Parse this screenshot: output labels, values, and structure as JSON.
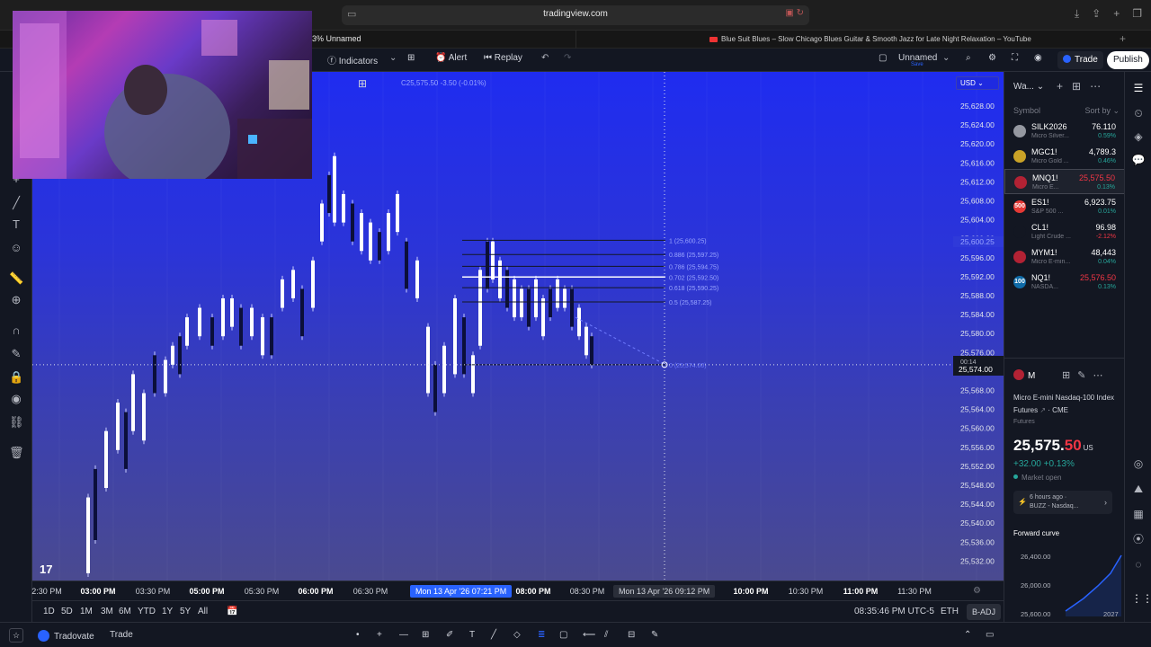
{
  "browser": {
    "url": "tradingview.com",
    "tab_left": "3% Unnamed",
    "tab_youtube": "Blue Suit Blues – Slow Chicago Blues Guitar & Smooth Jazz for Late Night Relaxation – YouTube"
  },
  "toolbar": {
    "indicators_label": "Indicators",
    "alert_label": "Alert",
    "replay_label": "Replay",
    "layout_name": "Unnamed",
    "layout_sub": "Save",
    "trade_label": "Trade",
    "publish_label": "Publish"
  },
  "chart": {
    "currency": "USD",
    "legend_ohlc": "C25,575.50  -3.50 (-0.01%)",
    "price_labels": [
      "25,628.00",
      "25,624.00",
      "25,620.00",
      "25,616.00",
      "25,612.00",
      "25,608.00",
      "25,604.00",
      "25,600.00",
      "25,596.00",
      "25,592.00",
      "25,588.00",
      "25,584.00",
      "25,580.00",
      "25,576.00",
      "25,572.00",
      "25,568.00",
      "25,564.00",
      "25,560.00",
      "25,556.00",
      "25,552.00",
      "25,548.00",
      "25,544.00",
      "25,540.00",
      "25,536.00",
      "25,532.00"
    ],
    "highlight_price_top": "25,600.25",
    "crosshair_price": "25,574.00",
    "crosshair_price_sub": "00:14",
    "fib_levels": [
      {
        "label": "1 (25,600.25)"
      },
      {
        "label": "0.886 (25,597.25)"
      },
      {
        "label": "0.786 (25,594.75)"
      },
      {
        "label": "0.702 (25,592.50)"
      },
      {
        "label": "0.618 (25,590.25)"
      },
      {
        "label": "0.5 (25,587.25)"
      },
      {
        "label": "0 (25,574.00)"
      }
    ],
    "time_labels": [
      {
        "text": "2:30 PM",
        "bold": false
      },
      {
        "text": "03:00 PM",
        "bold": true
      },
      {
        "text": "03:30 PM",
        "bold": false
      },
      {
        "text": "05:00 PM",
        "bold": true
      },
      {
        "text": "05:30 PM",
        "bold": false
      },
      {
        "text": "06:00 PM",
        "bold": true
      },
      {
        "text": "06:30 PM",
        "bold": false
      },
      {
        "text": "08:00 PM",
        "bold": true
      },
      {
        "text": "08:30 PM",
        "bold": false
      },
      {
        "text": "10:00 PM",
        "bold": true
      },
      {
        "text": "10:30 PM",
        "bold": false
      },
      {
        "text": "11:00 PM",
        "bold": true
      },
      {
        "text": "11:30 PM",
        "bold": false
      }
    ],
    "time_range_start": "Mon 13 Apr '26  07:21 PM",
    "time_crosshair": "Mon 13 Apr '26  09:12 PM",
    "ranges": [
      "1D",
      "5D",
      "1M",
      "3M",
      "6M",
      "YTD",
      "1Y",
      "5Y",
      "All"
    ],
    "clock": "08:35:46 PM UTC-5",
    "session": "ETH",
    "adjust": "B-ADJ"
  },
  "bottom": {
    "broker": "Tradovate",
    "trade": "Trade"
  },
  "watchlist": {
    "title": "Wa...",
    "col_symbol": "Symbol",
    "col_sort": "Sort by",
    "items": [
      {
        "symbol": "SILK2026",
        "desc": "Micro Silver...",
        "last": "76.110",
        "chg": "0.59%",
        "up": true,
        "color": "#9598a1",
        "badge": ""
      },
      {
        "symbol": "MGC1!",
        "desc": "Micro Gold ...",
        "last": "4,789.3",
        "chg": "0.46%",
        "up": true,
        "color": "#c9a227",
        "badge": ""
      },
      {
        "symbol": "MNQ1!",
        "desc": "Micro E...",
        "last": "25,575.50",
        "chg": "0.13%",
        "up": true,
        "color": "#b22234",
        "badge": "",
        "selected": true,
        "last_red": true
      },
      {
        "symbol": "ES1!",
        "desc": "S&P 500 ...",
        "last": "6,923.75",
        "chg": "0.01%",
        "up": true,
        "color": "#e53935",
        "badge": "500"
      },
      {
        "symbol": "CL1!",
        "desc": "Light Crude ...",
        "last": "96.98",
        "chg": "-2.12%",
        "up": false,
        "color": "#131722",
        "badge": ""
      },
      {
        "symbol": "MYM1!",
        "desc": "Micro E-min...",
        "last": "48,443",
        "chg": "0.04%",
        "up": true,
        "color": "#b22234",
        "badge": ""
      },
      {
        "symbol": "NQ1!",
        "desc": "NASDA...",
        "last": "25,576.50",
        "chg": "0.13%",
        "up": true,
        "color": "#0f6ba8",
        "badge": "100",
        "last_red": true
      }
    ]
  },
  "details": {
    "symbol": "M",
    "name": "Micro E-mini Nasdaq-100 Index Futures",
    "exchange": "CME",
    "type": "Futures",
    "price_main": "25,575.",
    "price_cents": "50",
    "price_unit": "US",
    "change": "+32.00  +0.13%",
    "status": "Market open",
    "news_time": "6 hours ago ·",
    "news_text": "BUZZ - Nasdaq...",
    "forward_curve": "Forward curve",
    "fc_labels": [
      "26,400.00",
      "26,000.00",
      "25,600.00"
    ],
    "fc_year": "2027"
  },
  "colors": {
    "bg": "#131722",
    "accent": "#2962ff",
    "up": "#26a69a",
    "down": "#f23645"
  }
}
